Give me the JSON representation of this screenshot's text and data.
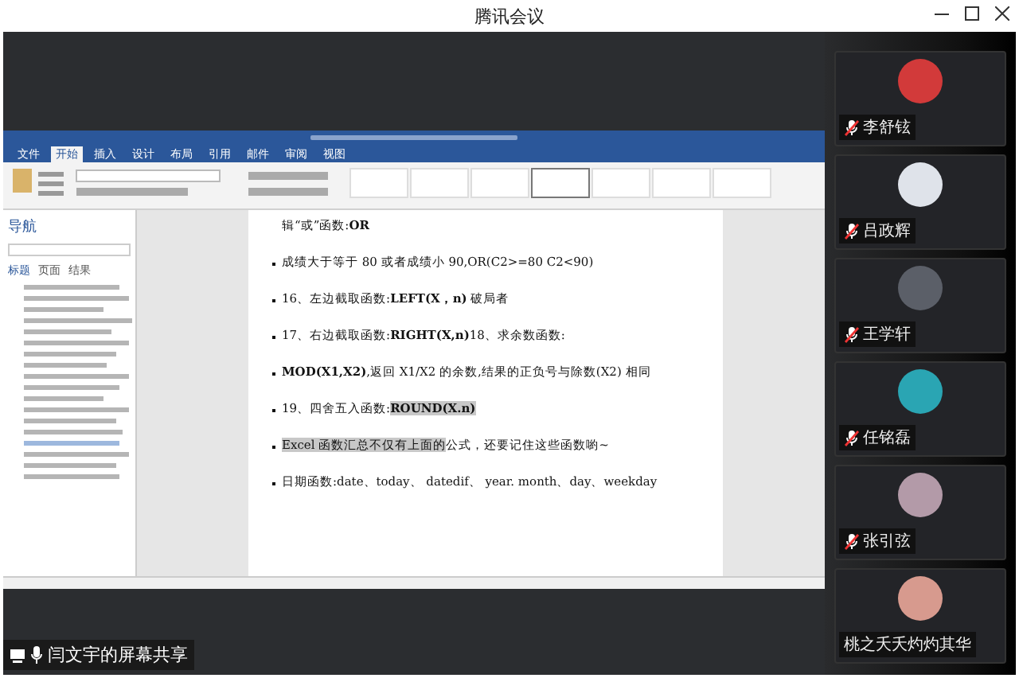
{
  "window": {
    "title": "腾讯会议"
  },
  "shared_screen": {
    "caption": "闫文宇的屏幕共享",
    "word": {
      "tabs": [
        {
          "label": "文件",
          "selected": false
        },
        {
          "label": "开始",
          "selected": true
        },
        {
          "label": "插入",
          "selected": false
        },
        {
          "label": "设计",
          "selected": false
        },
        {
          "label": "布局",
          "selected": false
        },
        {
          "label": "引用",
          "selected": false
        },
        {
          "label": "邮件",
          "selected": false
        },
        {
          "label": "审阅",
          "selected": false
        },
        {
          "label": "视图",
          "selected": false
        }
      ],
      "nav": {
        "title": "导航",
        "tabs": [
          {
            "label": "标题",
            "selected": true
          },
          {
            "label": "页面",
            "selected": false
          },
          {
            "label": "结果",
            "selected": false
          }
        ]
      },
      "document": [
        {
          "bullet": false,
          "segments": [
            {
              "text": "辑“或”函数:",
              "bold": false,
              "highlighted": false
            },
            {
              "text": "OR",
              "bold": true,
              "highlighted": false
            }
          ]
        },
        {
          "bullet": true,
          "segments": [
            {
              "text": "成绩大于等于 80 或者成绩小 90,OR(C2>=80 C2<90)",
              "bold": false,
              "highlighted": false
            }
          ]
        },
        {
          "bullet": true,
          "segments": [
            {
              "text": "16、左边截取函数:",
              "bold": false,
              "highlighted": false
            },
            {
              "text": "LEFT(X，n)",
              "bold": true,
              "highlighted": false
            },
            {
              "text": "  破局者",
              "bold": false,
              "highlighted": false
            }
          ]
        },
        {
          "bullet": true,
          "segments": [
            {
              "text": "17、右边截取函数:",
              "bold": false,
              "highlighted": false
            },
            {
              "text": "RIGHT(X,n)",
              "bold": true,
              "highlighted": false
            },
            {
              "text": "18、求余数函数:",
              "bold": false,
              "highlighted": false
            }
          ]
        },
        {
          "bullet": true,
          "segments": [
            {
              "text": "MOD(X1,X2)",
              "bold": true,
              "highlighted": false
            },
            {
              "text": ",返回 X1/X2 的余数,结果的正负号与除数(X2) 相同",
              "bold": false,
              "highlighted": false
            }
          ]
        },
        {
          "bullet": true,
          "segments": [
            {
              "text": "19、四舍五入函数:",
              "bold": false,
              "highlighted": false
            },
            {
              "text": "ROUND(X.n)",
              "bold": true,
              "highlighted": true
            }
          ]
        },
        {
          "bullet": true,
          "segments": [
            {
              "text": "Excel 函数汇总不仅有上面的",
              "bold": false,
              "highlighted": true
            },
            {
              "text": "公式，还要记住这些函数喲~",
              "bold": false,
              "highlighted": false
            }
          ]
        },
        {
          "bullet": true,
          "segments": [
            {
              "text": "日期函数:date、today、 datedif、 year. month、day、weekday",
              "bold": false,
              "highlighted": false
            }
          ]
        }
      ]
    }
  },
  "participants": [
    {
      "name": "李舒铉",
      "muted": true
    },
    {
      "name": "吕政辉",
      "muted": true
    },
    {
      "name": "王学轩",
      "muted": true
    },
    {
      "name": "任铭磊",
      "muted": true
    },
    {
      "name": "张引弦",
      "muted": true
    },
    {
      "name": "桃之夭夭灼灼其华",
      "muted": false
    }
  ]
}
